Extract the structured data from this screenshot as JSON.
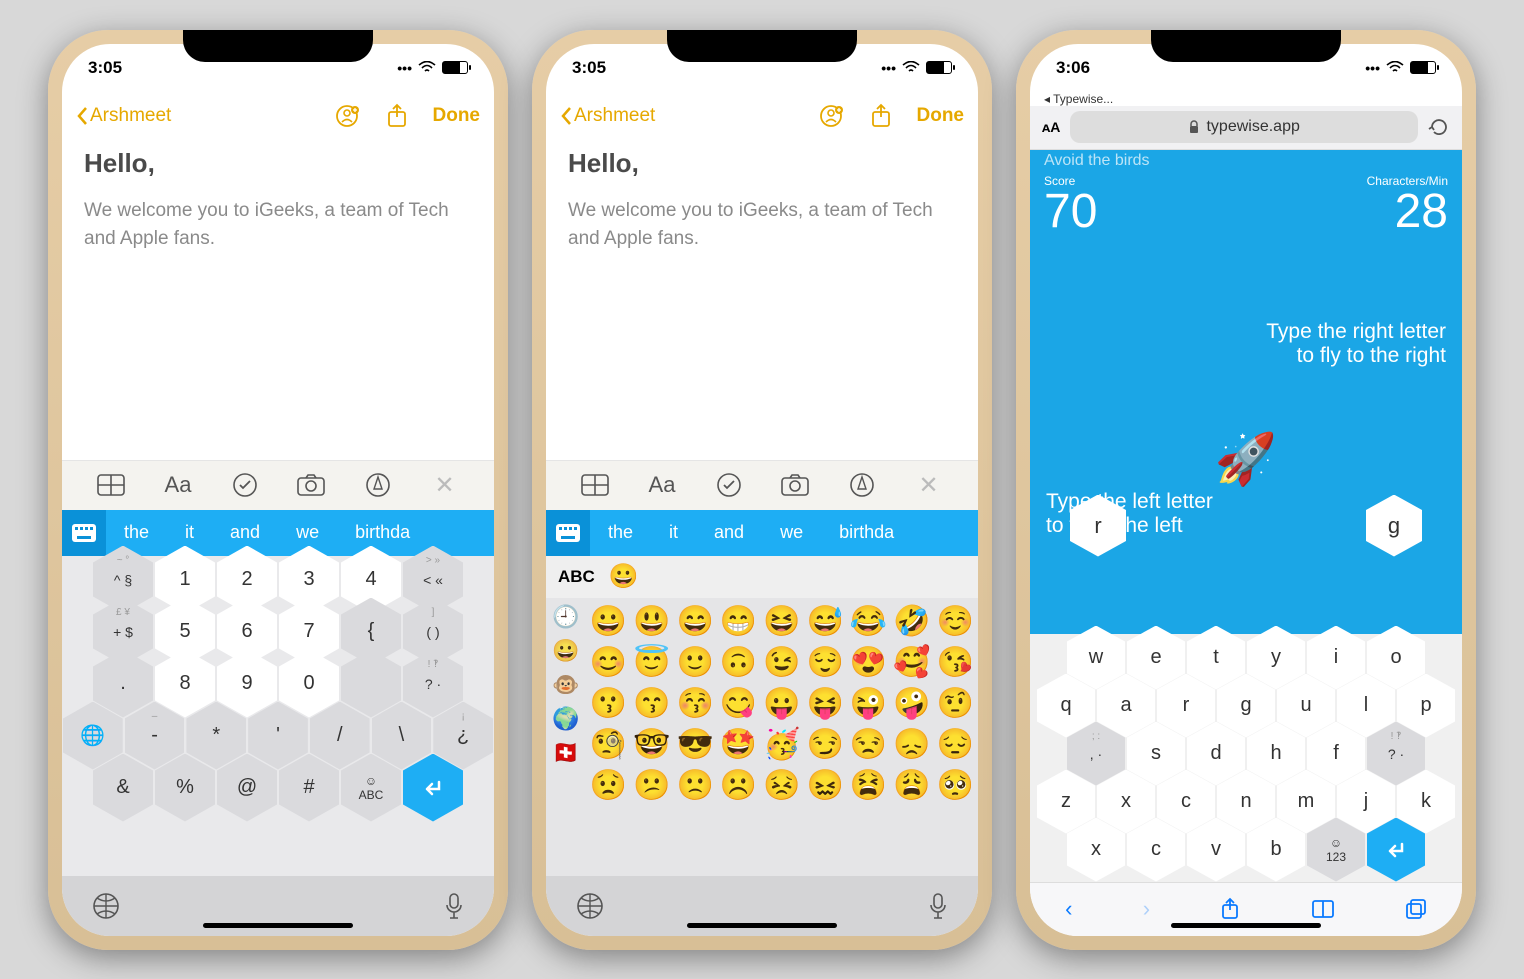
{
  "phone1": {
    "time": "3:05",
    "back": "Arshmeet",
    "done": "Done",
    "title": "Hello,",
    "body": "We welcome you to iGeeks, a team of Tech and Apple fans.",
    "suggestions": [
      "the",
      "it",
      "and",
      "we",
      "birthda"
    ],
    "keys_r1_sup": [
      "~ °",
      "",
      "",
      "",
      "",
      "> »"
    ],
    "keys_r1": [
      "^ §",
      "1",
      "2",
      "3",
      "4",
      "< «"
    ],
    "keys_r2_sup": [
      "£ ¥",
      "=",
      "",
      "",
      "",
      "[",
      "]"
    ],
    "keys_r2": [
      "+ $",
      "5",
      "6",
      "7",
      "{",
      "( )"
    ],
    "keys_r3_sup": [
      "",
      "",
      "",
      "",
      "",
      "! ‽"
    ],
    "keys_r3": [
      ".",
      "8",
      "9",
      "0",
      "",
      "? ·"
    ],
    "keys_r4_sup": [
      "",
      "–",
      "",
      "",
      "",
      "",
      "¡"
    ],
    "keys_r4": [
      "🌐",
      "-",
      "*",
      "'",
      "/",
      "\\",
      "¿"
    ],
    "keys_r5": [
      "&",
      "%",
      "@",
      "#",
      "☺\nABC",
      "↩"
    ]
  },
  "phone2": {
    "time": "3:05",
    "back": "Arshmeet",
    "done": "Done",
    "title": "Hello,",
    "body": "We welcome you to iGeeks, a team of Tech and Apple fans.",
    "suggestions": [
      "the",
      "it",
      "and",
      "we",
      "birthda"
    ],
    "abc": "ABC",
    "categories": [
      "🕘",
      "😀",
      "🐵",
      "🌍",
      "🇨🇭"
    ],
    "emoji_rows": [
      [
        "😀",
        "😃",
        "😄",
        "😁",
        "😆",
        "😅",
        "😂",
        "🤣",
        "☺️"
      ],
      [
        "😊",
        "😇",
        "🙂",
        "🙃",
        "😉",
        "😌",
        "😍",
        "🥰",
        "😘"
      ],
      [
        "😗",
        "😙",
        "😚",
        "😋",
        "😛",
        "😝",
        "😜",
        "🤪",
        "🤨"
      ],
      [
        "🧐",
        "🤓",
        "😎",
        "🤩",
        "🥳",
        "😏",
        "😒",
        "😞",
        "😔"
      ],
      [
        "😟",
        "😕",
        "🙁",
        "☹️",
        "😣",
        "😖",
        "😫",
        "😩",
        "🥺"
      ]
    ]
  },
  "phone3": {
    "time": "3:06",
    "back_app": "◂ Typewise...",
    "url": "typewise.app",
    "subtitle": "Avoid the birds",
    "score_label": "Score",
    "score": "70",
    "cpm_label": "Characters/Min",
    "cpm": "28",
    "instr_right_1": "Type the right letter",
    "instr_right_2": "to fly to the right",
    "instr_left_1": "Type the left letter",
    "instr_left_2": "to fly to the left",
    "left_letter": "r",
    "right_letter": "g",
    "keys_r1": [
      "w",
      "e",
      "t",
      "y",
      "i",
      "o"
    ],
    "keys_r2": [
      "q",
      "a",
      "r",
      "g",
      "u",
      "l",
      "p"
    ],
    "keys_r3_sup": [
      "; :",
      "",
      "",
      "",
      "",
      "! ‽"
    ],
    "keys_r3": [
      ", ·",
      "s",
      "d",
      "h",
      "f",
      "? ·"
    ],
    "keys_r4": [
      "z",
      "x",
      "c",
      "n",
      "m",
      "j",
      "k"
    ],
    "keys_r5": [
      "x",
      "c",
      "v",
      "b",
      "☺\n123",
      "↩"
    ]
  }
}
